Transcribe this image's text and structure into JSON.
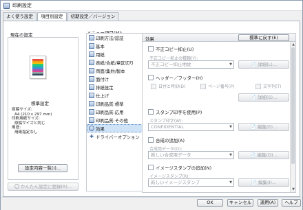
{
  "window": {
    "title": "印刷設定"
  },
  "tabs": [
    {
      "label": "よく使う設定"
    },
    {
      "label": "項目別設定"
    },
    {
      "label": "初期設定／バージョン"
    }
  ],
  "left_panel": {
    "group_label": "現在の設定",
    "standard_label": "標準設定",
    "summary_lines": [
      "原稿サイズ:",
      "A4 (210 x 297 mm)",
      "印刷用紙サイズ:",
      "原稿サイズと同じ",
      "用途:",
      "用紙指定なし"
    ],
    "settings_list_button": "設定内容一覧(I)...",
    "register_button": "かんたん設定に登録(R)..."
  },
  "menu": {
    "label": "メニュー項目(M):",
    "items": [
      "印刷方法/認証",
      "基本",
      "用紙",
      "表紙/合紙/章区切り",
      "両面/集約/製本",
      "面付け",
      "排紙設定",
      "仕上げ",
      "印刷品質:標準",
      "印刷品質:応用",
      "印刷品質:その他",
      "効果",
      "ドライバーオプション"
    ]
  },
  "pane": {
    "title": "効果",
    "default_button": "標準に戻す(E)",
    "copy_guard": {
      "checkbox": "不正コピー抑止(U)",
      "type_label": "不正コピー抑止の種類(Y):",
      "type_value": "不正コピー抑止地紋",
      "details": "詳細(L)..."
    },
    "header_footer": {
      "checkbox": "ヘッダー／フッター(H)",
      "date": "日付と時刻(D)",
      "page": "ページ番号(P)",
      "text": "文字列(T)",
      "details": "詳細(S)..."
    },
    "stamp": {
      "checkbox": "スタンプ印字を使用(P)",
      "label": "スタンプ印字(W):",
      "value": "CONFIDENTIAL",
      "edit": "編集(E)..."
    },
    "overlay": {
      "checkbox": "合成の追加(A)",
      "label": "合成用データ(O):",
      "value": "新しい合成用データ",
      "edit": "編集(D)..."
    },
    "image_stamp": {
      "checkbox": "イメージスタンプの追加(N)",
      "label": "イメージスタンプ(R):",
      "value": "新しいイメージスタンプ",
      "edit": "編集(I)..."
    }
  },
  "footer": {
    "ok": "OK",
    "cancel": "キャンセル",
    "apply": "適用(A)",
    "help": "ヘルプ"
  }
}
